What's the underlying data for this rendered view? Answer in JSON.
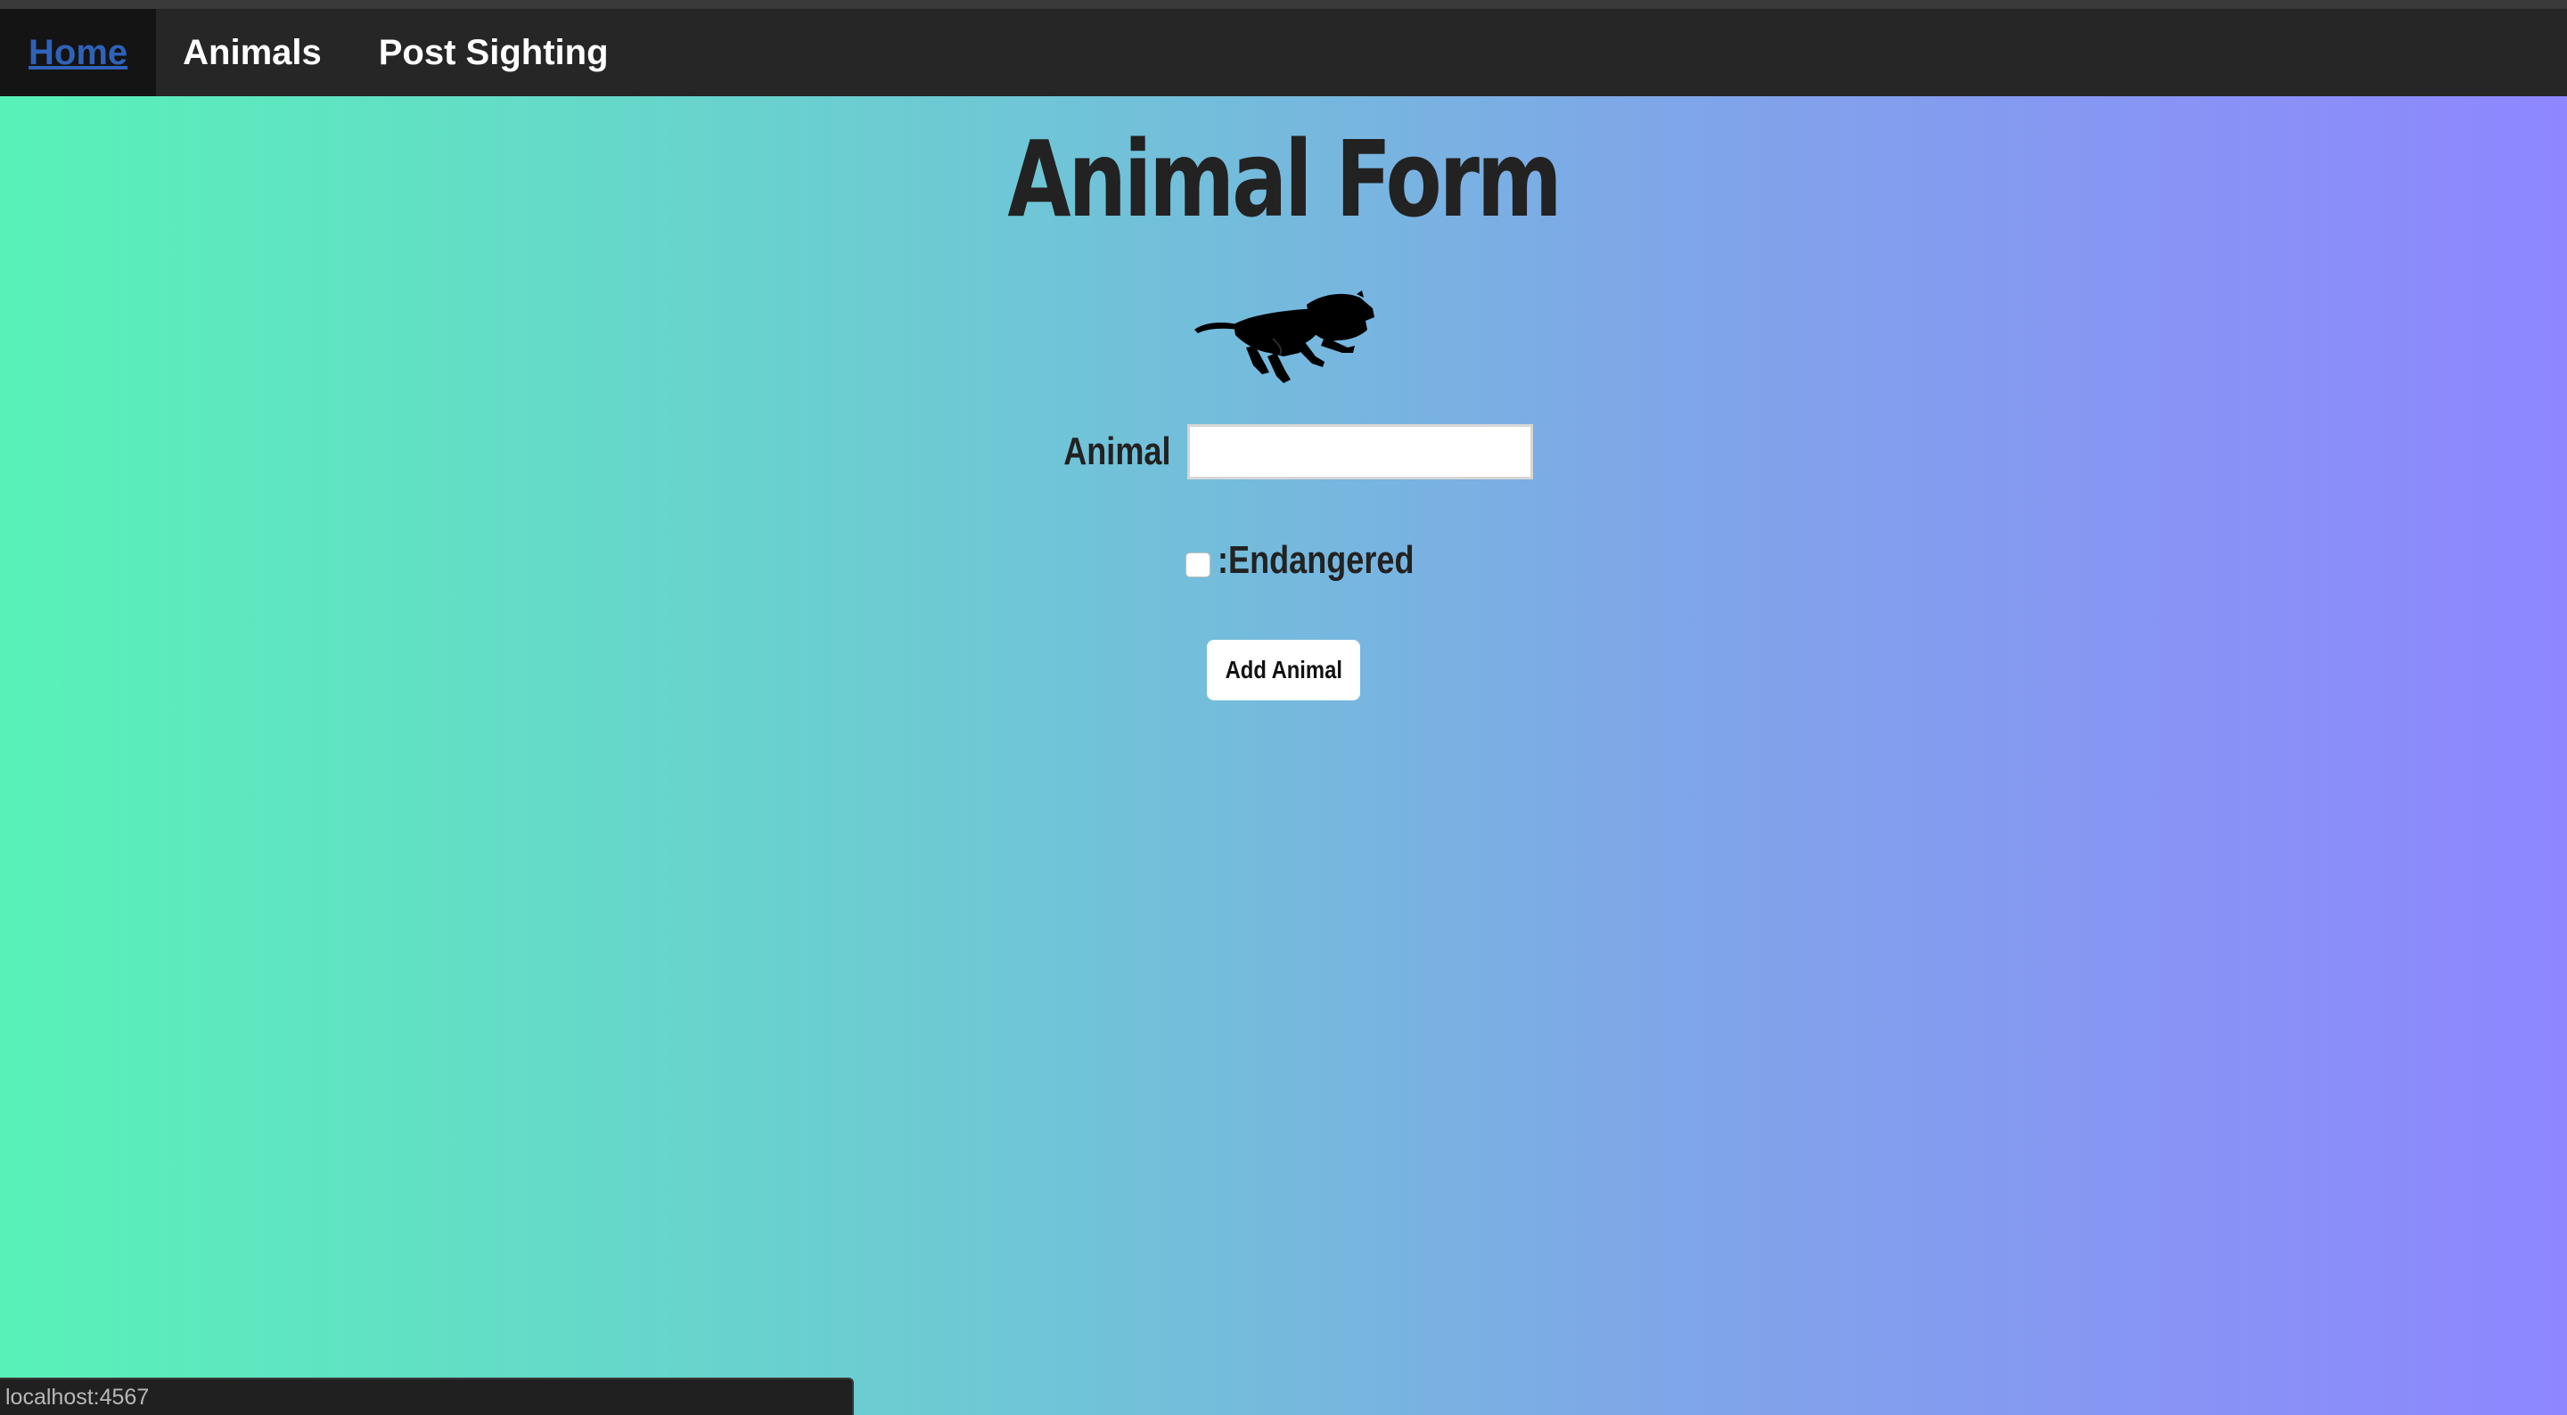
{
  "nav": {
    "items": [
      {
        "label": "Home",
        "active": true
      },
      {
        "label": "Animals",
        "active": false
      },
      {
        "label": "Post Sighting",
        "active": false
      }
    ]
  },
  "page": {
    "title": "Animal Form",
    "logo_icon": "running-lion-icon"
  },
  "form": {
    "animal_label": "Animal",
    "animal_value": "",
    "endangered_label": ":Endangered",
    "endangered_checked": false,
    "submit_label": "Add Animal"
  },
  "status_bar": {
    "url": "localhost:4567"
  },
  "colors": {
    "gradient_start": "#58f2b8",
    "gradient_end": "#8e86ff",
    "navbar": "#262626",
    "active_link": "#2f62b8",
    "text_dark": "#222222"
  }
}
